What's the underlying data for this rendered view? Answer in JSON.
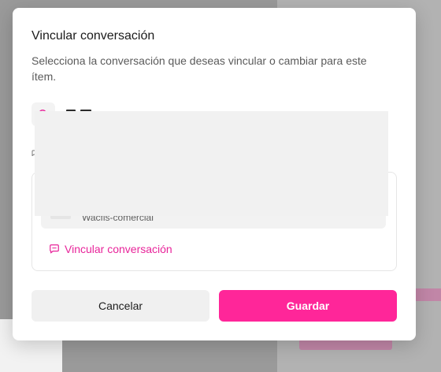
{
  "modal": {
    "title": "Vincular conversación",
    "description": "Selecciona la conversación que deseas vincular o cambiar para este ítem."
  },
  "conversation_list": {
    "items": [
      {
        "label": "Wacfis-comercial"
      }
    ]
  },
  "link_conversation": {
    "label": "Vincular conversación",
    "icon": "chat-icon"
  },
  "buttons": {
    "cancel_label": "Cancelar",
    "save_label": "Guardar"
  },
  "colors": {
    "accent": "#ff2699",
    "link": "#e8249a"
  }
}
